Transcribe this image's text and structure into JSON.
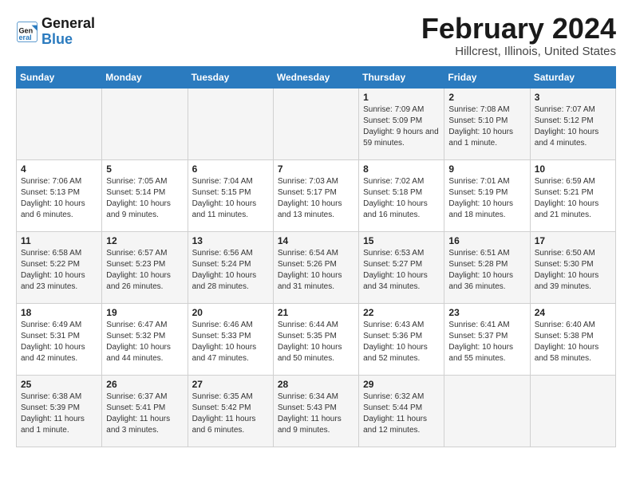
{
  "header": {
    "logo_line1": "General",
    "logo_line2": "Blue",
    "main_title": "February 2024",
    "subtitle": "Hillcrest, Illinois, United States"
  },
  "columns": [
    "Sunday",
    "Monday",
    "Tuesday",
    "Wednesday",
    "Thursday",
    "Friday",
    "Saturday"
  ],
  "weeks": [
    {
      "days": [
        {
          "number": "",
          "info": ""
        },
        {
          "number": "",
          "info": ""
        },
        {
          "number": "",
          "info": ""
        },
        {
          "number": "",
          "info": ""
        },
        {
          "number": "1",
          "info": "Sunrise: 7:09 AM\nSunset: 5:09 PM\nDaylight: 9 hours and 59 minutes."
        },
        {
          "number": "2",
          "info": "Sunrise: 7:08 AM\nSunset: 5:10 PM\nDaylight: 10 hours and 1 minute."
        },
        {
          "number": "3",
          "info": "Sunrise: 7:07 AM\nSunset: 5:12 PM\nDaylight: 10 hours and 4 minutes."
        }
      ]
    },
    {
      "days": [
        {
          "number": "4",
          "info": "Sunrise: 7:06 AM\nSunset: 5:13 PM\nDaylight: 10 hours and 6 minutes."
        },
        {
          "number": "5",
          "info": "Sunrise: 7:05 AM\nSunset: 5:14 PM\nDaylight: 10 hours and 9 minutes."
        },
        {
          "number": "6",
          "info": "Sunrise: 7:04 AM\nSunset: 5:15 PM\nDaylight: 10 hours and 11 minutes."
        },
        {
          "number": "7",
          "info": "Sunrise: 7:03 AM\nSunset: 5:17 PM\nDaylight: 10 hours and 13 minutes."
        },
        {
          "number": "8",
          "info": "Sunrise: 7:02 AM\nSunset: 5:18 PM\nDaylight: 10 hours and 16 minutes."
        },
        {
          "number": "9",
          "info": "Sunrise: 7:01 AM\nSunset: 5:19 PM\nDaylight: 10 hours and 18 minutes."
        },
        {
          "number": "10",
          "info": "Sunrise: 6:59 AM\nSunset: 5:21 PM\nDaylight: 10 hours and 21 minutes."
        }
      ]
    },
    {
      "days": [
        {
          "number": "11",
          "info": "Sunrise: 6:58 AM\nSunset: 5:22 PM\nDaylight: 10 hours and 23 minutes."
        },
        {
          "number": "12",
          "info": "Sunrise: 6:57 AM\nSunset: 5:23 PM\nDaylight: 10 hours and 26 minutes."
        },
        {
          "number": "13",
          "info": "Sunrise: 6:56 AM\nSunset: 5:24 PM\nDaylight: 10 hours and 28 minutes."
        },
        {
          "number": "14",
          "info": "Sunrise: 6:54 AM\nSunset: 5:26 PM\nDaylight: 10 hours and 31 minutes."
        },
        {
          "number": "15",
          "info": "Sunrise: 6:53 AM\nSunset: 5:27 PM\nDaylight: 10 hours and 34 minutes."
        },
        {
          "number": "16",
          "info": "Sunrise: 6:51 AM\nSunset: 5:28 PM\nDaylight: 10 hours and 36 minutes."
        },
        {
          "number": "17",
          "info": "Sunrise: 6:50 AM\nSunset: 5:30 PM\nDaylight: 10 hours and 39 minutes."
        }
      ]
    },
    {
      "days": [
        {
          "number": "18",
          "info": "Sunrise: 6:49 AM\nSunset: 5:31 PM\nDaylight: 10 hours and 42 minutes."
        },
        {
          "number": "19",
          "info": "Sunrise: 6:47 AM\nSunset: 5:32 PM\nDaylight: 10 hours and 44 minutes."
        },
        {
          "number": "20",
          "info": "Sunrise: 6:46 AM\nSunset: 5:33 PM\nDaylight: 10 hours and 47 minutes."
        },
        {
          "number": "21",
          "info": "Sunrise: 6:44 AM\nSunset: 5:35 PM\nDaylight: 10 hours and 50 minutes."
        },
        {
          "number": "22",
          "info": "Sunrise: 6:43 AM\nSunset: 5:36 PM\nDaylight: 10 hours and 52 minutes."
        },
        {
          "number": "23",
          "info": "Sunrise: 6:41 AM\nSunset: 5:37 PM\nDaylight: 10 hours and 55 minutes."
        },
        {
          "number": "24",
          "info": "Sunrise: 6:40 AM\nSunset: 5:38 PM\nDaylight: 10 hours and 58 minutes."
        }
      ]
    },
    {
      "days": [
        {
          "number": "25",
          "info": "Sunrise: 6:38 AM\nSunset: 5:39 PM\nDaylight: 11 hours and 1 minute."
        },
        {
          "number": "26",
          "info": "Sunrise: 6:37 AM\nSunset: 5:41 PM\nDaylight: 11 hours and 3 minutes."
        },
        {
          "number": "27",
          "info": "Sunrise: 6:35 AM\nSunset: 5:42 PM\nDaylight: 11 hours and 6 minutes."
        },
        {
          "number": "28",
          "info": "Sunrise: 6:34 AM\nSunset: 5:43 PM\nDaylight: 11 hours and 9 minutes."
        },
        {
          "number": "29",
          "info": "Sunrise: 6:32 AM\nSunset: 5:44 PM\nDaylight: 11 hours and 12 minutes."
        },
        {
          "number": "",
          "info": ""
        },
        {
          "number": "",
          "info": ""
        }
      ]
    }
  ]
}
